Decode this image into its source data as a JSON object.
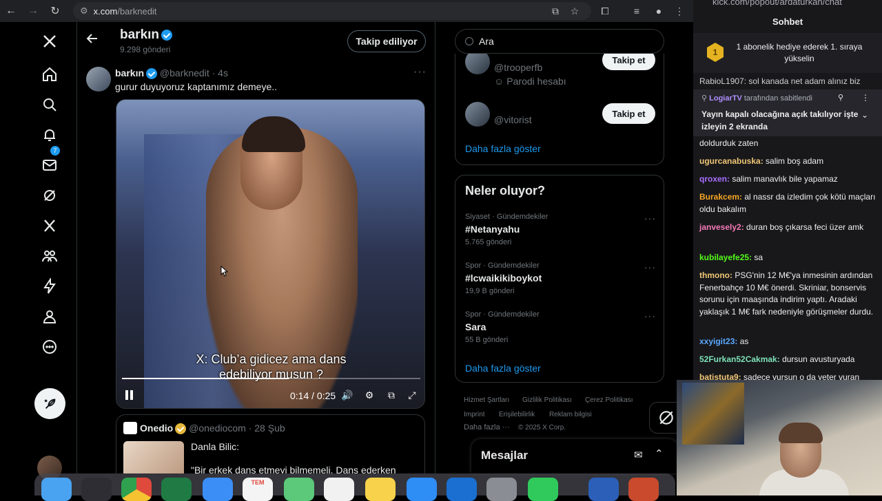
{
  "browser": {
    "url_host": "x.com",
    "url_path": "/barknedit"
  },
  "nav": {
    "notification_count": "7"
  },
  "profile": {
    "name": "barkın",
    "posts": "9.298 gönderi",
    "follow_label": "Takip ediliyor"
  },
  "tweet": {
    "name": "barkın",
    "handle": "@barknedit",
    "time": "· 4s",
    "text": "gurur duyuyoruz kaptanımız demeye..",
    "subtitle_line1": "X: Club’a gidicez ama dans",
    "subtitle_line2": "edebiliyor musun ?",
    "video_time": "0:14 / 0:25",
    "progress": 0.56
  },
  "quote": {
    "name": "Onedio",
    "handle": "@onediocom",
    "time": "· 28 Şub",
    "line1": "Danla Bilic:",
    "line2": "\"Bir erkek dans etmeyi bilmemeli. Dans ederken"
  },
  "search": {
    "placeholder": "Ara"
  },
  "who_to_follow": {
    "items": [
      {
        "handle": "@trooperfb",
        "sub": "Parodi hesabı",
        "follow_label": "Takip et"
      },
      {
        "handle": "@vitorist",
        "follow_label": "Takip et"
      }
    ],
    "show_more": "Daha fazla göster"
  },
  "trends": {
    "title": "Neler oluyor?",
    "items": [
      {
        "category": "Siyaset · Gündemdekiler",
        "name": "#Netanyahu",
        "count": "5.765 gönderi"
      },
      {
        "category": "Spor · Gündemdekiler",
        "name": "#lcwaikikiboykot",
        "count": "19,9 B gönderi"
      },
      {
        "category": "Spor · Gündemdekiler",
        "name": "Sara",
        "count": "55 B gönderi"
      }
    ],
    "show_more": "Daha fazla göster"
  },
  "footer": {
    "links": [
      "Hizmet Şartları",
      "Gizlilik Politikası",
      "Çerez Politikası",
      "Imprint",
      "Erişilebilirlik",
      "Reklam bilgisi",
      "Daha fazla ···",
      "© 2025 X Corp."
    ]
  },
  "messages": {
    "title": "Mesajlar"
  },
  "chat": {
    "url": "kick.com/popout/ardaturkan/chat",
    "title": "Sohbet",
    "gift_rank": "1",
    "gift_text": "1 abonelik hediye ederek 1. sıraya yükselin",
    "top_cut_line": "RabioL1907: sol kanada net adam alınız biz",
    "pinned_by_user": "LogiarTV",
    "pinned_by_suffix": "tarafından sabitlendi",
    "pinned_text": "Yayın kapalı olacağına açık takılıyor işte izleyin 2 ekranda",
    "messages": [
      {
        "user": "",
        "text": "doldurduk zaten",
        "color": "#efeff1"
      },
      {
        "user": "ugurcanabuska:",
        "text": " salim boş adam",
        "color": "#f0c674"
      },
      {
        "user": "qroxen:",
        "text": " salim manavlık bile yapamaz",
        "color": "#a970ff"
      },
      {
        "user": "Burakcem:",
        "text": " al nassr da izledim çok kötü maçları oldu bakalım",
        "color": "#f5a623"
      },
      {
        "user": "janvesely2:",
        "text": " duran boş çıkarsa feci üzer amk",
        "color": "#f57ab6"
      },
      {
        "user": "kubilayefe25:",
        "text": " sa",
        "color": "#53fc18"
      },
      {
        "user": "thmono:",
        "text": " PSG'nin 12 M€'ya inmesinin ardından Fenerbahçe 10 M€ önerdi. Skriniar, bonservis sorunu için maaşında indirim yaptı. Aradaki yaklaşık 1 M€ fark nedeniyle görüşmeler durdu.",
        "color": "#f0c674"
      },
      {
        "user": "xxyigit23:",
        "text": " as",
        "color": "#5aa9ff"
      },
      {
        "user": "52Furkan52Cakmak:",
        "text": " dursun avusturyada",
        "color": "#7ee2b8"
      },
      {
        "user": "batistuta9:",
        "text": " sadece vursun o da yeter vuran",
        "color": "#f0c674"
      }
    ]
  },
  "dock": {
    "calendar_month": "TEM"
  }
}
